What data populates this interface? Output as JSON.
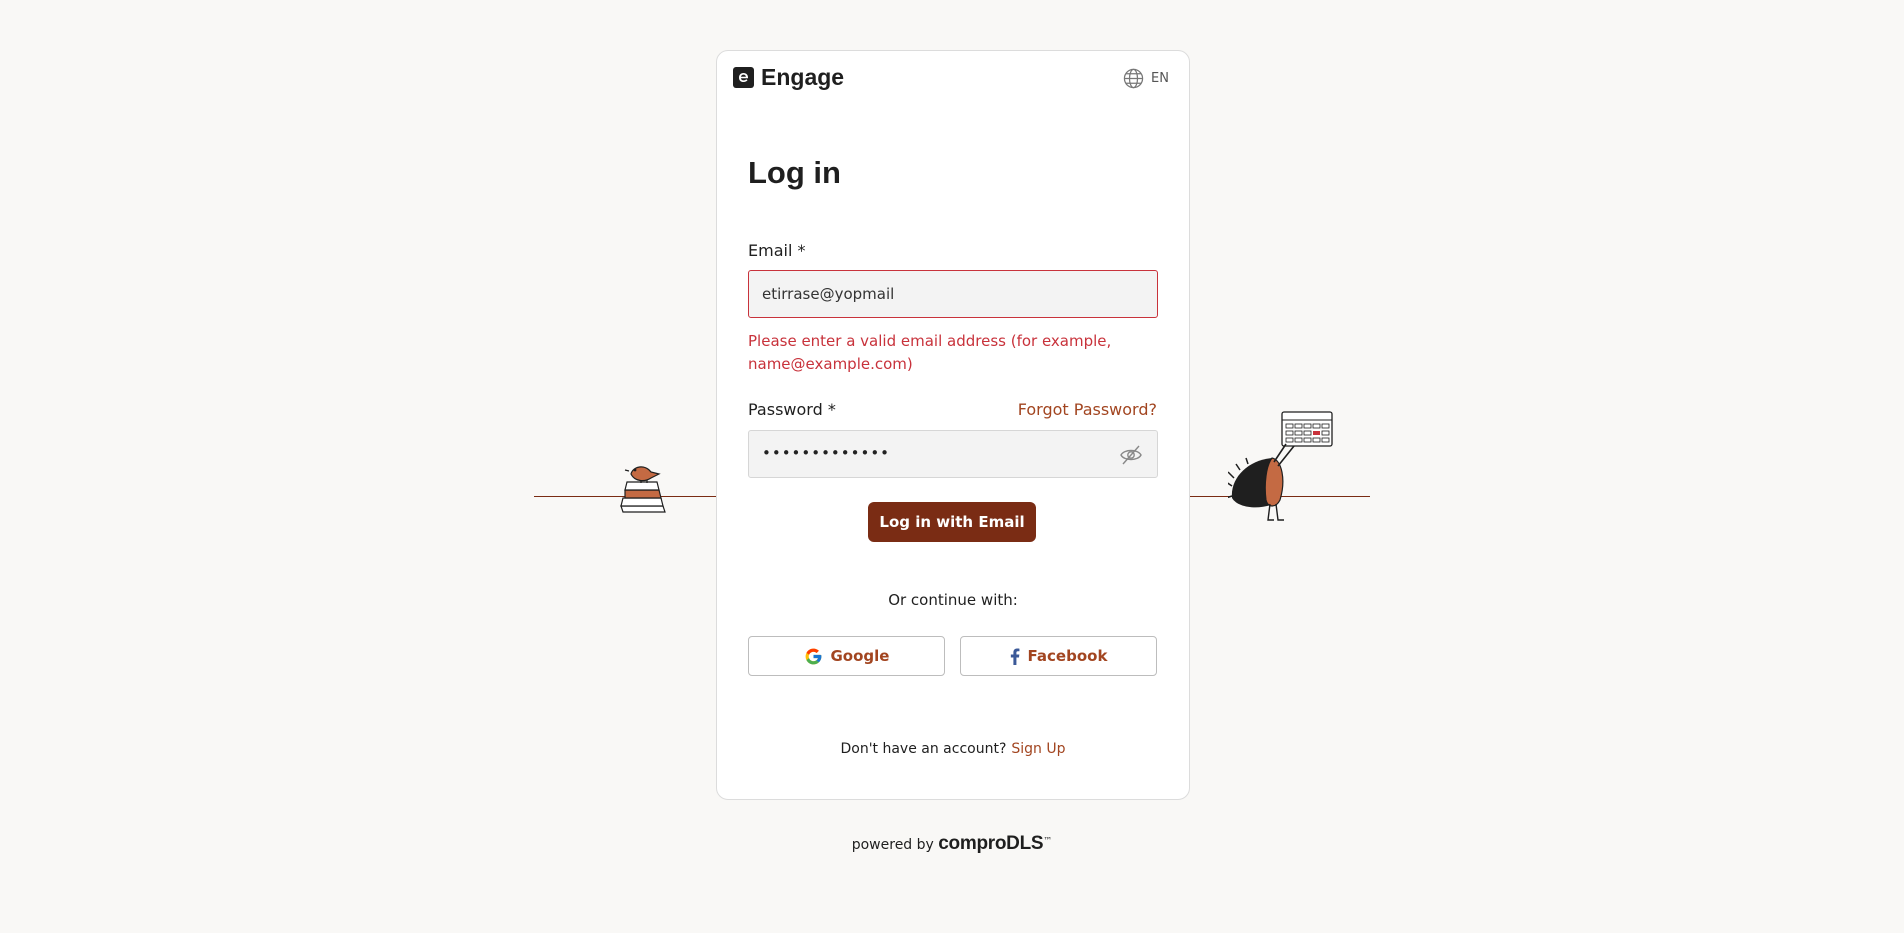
{
  "header": {
    "brand_letter": "e",
    "brand_name": "Engage",
    "language": "EN"
  },
  "form": {
    "title": "Log in",
    "email_label": "Email *",
    "email_value": "etirrase@yopmail",
    "email_error": "Please enter a valid email address (for example, name@example.com)",
    "password_label": "Password *",
    "forgot_password": "Forgot Password?",
    "password_value": "•••••••••••••",
    "submit_label": "Log in with Email",
    "or_continue": "Or continue with:",
    "google_label": "Google",
    "facebook_label": "Facebook",
    "no_account": "Don't have an account?",
    "sign_up": "Sign Up"
  },
  "footer": {
    "powered_by": "powered by",
    "brand": "comproDLS",
    "trademark": "™"
  },
  "colors": {
    "accent": "#7a2c14",
    "link": "#a24520",
    "error": "#c8323b",
    "background": "#f9f8f6"
  }
}
